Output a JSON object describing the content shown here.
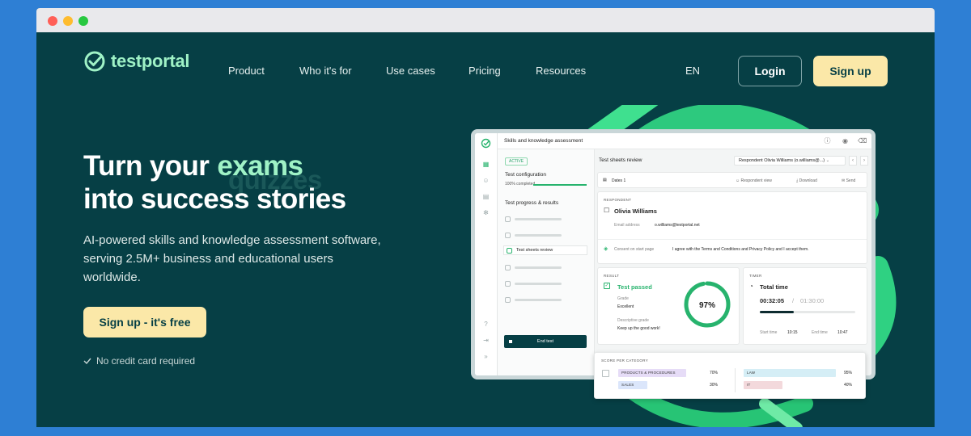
{
  "nav": {
    "logo": "testportal",
    "items": [
      "Product",
      "Who it's for",
      "Use cases",
      "Pricing",
      "Resources"
    ],
    "language": "EN",
    "login": "Login",
    "signup": "Sign up"
  },
  "hero": {
    "line1": "Turn your",
    "accent": "exams",
    "ghost_word": "quizzes",
    "line2": "into success stories",
    "subtitle": "AI-powered skills and knowledge assessment software, serving 2.5M+ business and educational users worldwide.",
    "cta": "Sign up - it's free",
    "note": "No credit card required"
  },
  "app": {
    "title": "Skills and knowledge assessment",
    "status": "ACTIVE",
    "config_label": "Test configuration",
    "config_progress": "100% completed",
    "progress_label": "Test progress & results",
    "active_item": "Test sheets review",
    "end_test": "End test",
    "review_title": "Test sheets review",
    "respondent_select": "Respondent  Olivia Williams (o.williams@...)",
    "dates": "Dates  1",
    "respondent_view": "Respondent view",
    "download": "Download",
    "send": "Send",
    "respondent_header": "RESPONDENT",
    "respondent_name": "Olivia Williams",
    "email_label": "Email address",
    "email": "o.williams@testportal.net",
    "consent_label": "Consent on start page",
    "consent_text": "I agree with the Terms and Conditions and Privacy Policy and I accept them.",
    "result_header": "RESULT",
    "result": "Test passed",
    "grade_label": "Grade",
    "grade": "Excellent",
    "desc_grade_label": "Descriptive grade",
    "desc_grade": "Keep up the good work!",
    "score": "97%",
    "score_value": 0.97,
    "timer_header": "TIMER",
    "total_time_label": "Total time",
    "time_used": "00:32:05",
    "time_sep": "/",
    "time_total": "01:30:00",
    "time_fraction": 0.36,
    "start_label": "Start time",
    "start": "10:15",
    "end_label": "End time",
    "end": "10:47",
    "category_header": "SCORE PER CATEGORY",
    "categories": [
      {
        "name": "PRODUCTS & PROCEDURES",
        "pct": "70%",
        "value": 0.7,
        "color": "#e6dcf7"
      },
      {
        "name": "SALES",
        "pct": "30%",
        "value": 0.3,
        "color": "#dbe6fb"
      },
      {
        "name": "LAW",
        "pct": "95%",
        "value": 0.95,
        "color": "#d5eef6"
      },
      {
        "name": "IT",
        "pct": "40%",
        "value": 0.4,
        "color": "#f3d9dc"
      }
    ]
  },
  "colors": {
    "background": "#063f45",
    "accent": "#9ff2c6",
    "cta": "#fbe8a8"
  }
}
